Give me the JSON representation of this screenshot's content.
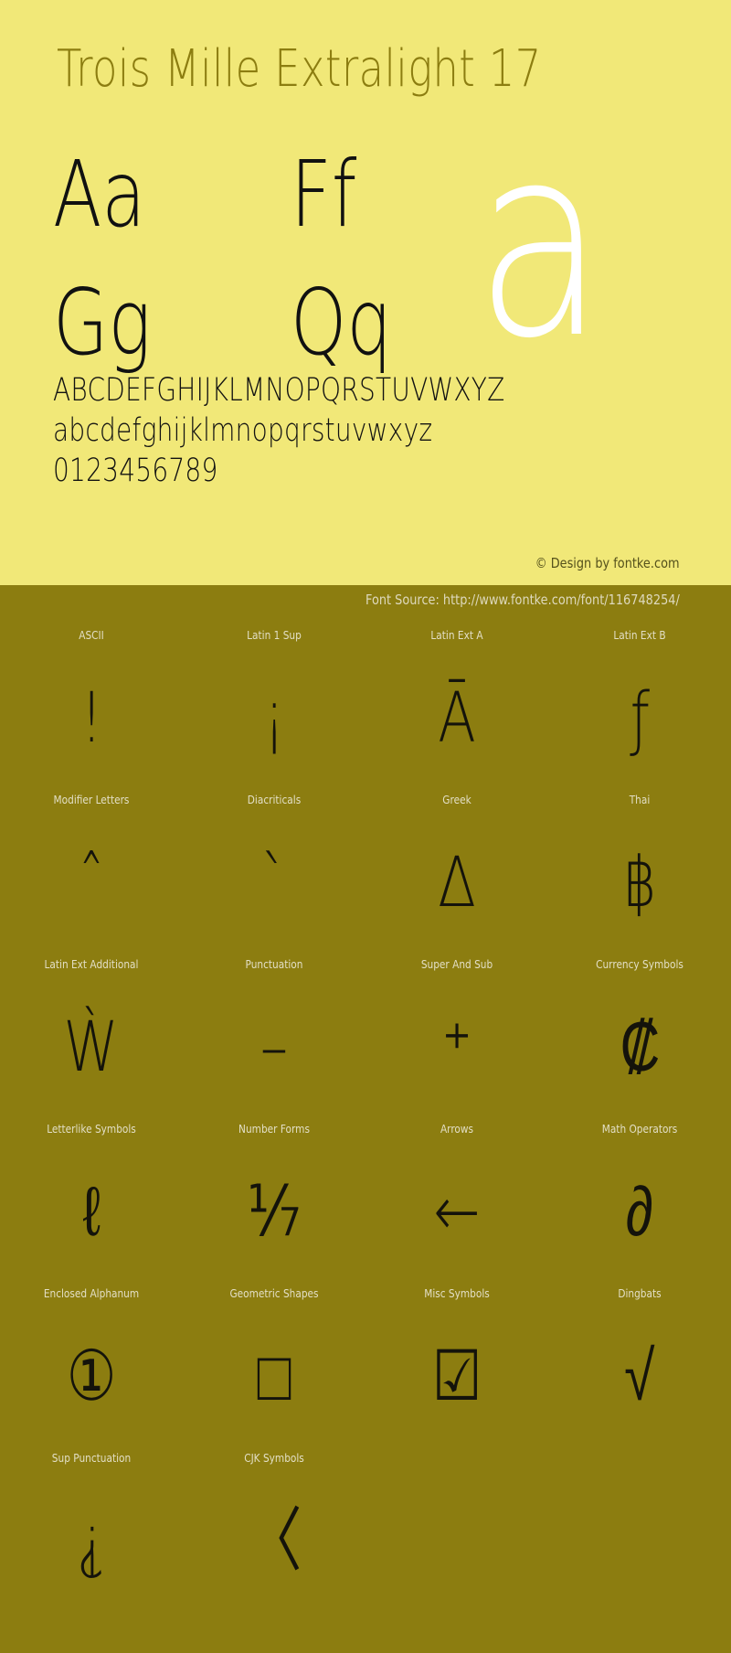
{
  "hero": {
    "title": "Trois Mille Extralight 17",
    "watermark_glyph": "a",
    "letter_pairs": [
      [
        "Aa",
        "Ff"
      ],
      [
        "Gg",
        "Qq"
      ]
    ],
    "alphabet_uppercase": "ABCDEFGHIJKLMNOPQRSTUVWXYZ",
    "alphabet_lowercase": "abcdefghijklmnopqrstuvwxyz",
    "digits": "0123456789",
    "credit": "© Design by fontke.com",
    "background_color": "#f1e878",
    "title_color": "#8c7d10",
    "glyph_color": "#111111"
  },
  "source": {
    "text": "Font Source: http://www.fontke.com/font/116748254/",
    "background_color": "#8c7d10",
    "text_color": "#ded9bd"
  },
  "grid": {
    "rows": [
      {
        "labels": [
          "ASCII",
          "Latin 1 Sup",
          "Latin Ext A",
          "Latin Ext B"
        ],
        "glyphs": [
          "!",
          "¡",
          "Ā",
          "ƒ"
        ]
      },
      {
        "labels": [
          "Modifier Letters",
          "Diacriticals",
          "Greek",
          "Thai"
        ],
        "glyphs": [
          "ˆ",
          "ˋ",
          "Δ",
          "฿"
        ]
      },
      {
        "labels": [
          "Latin Ext Additional",
          "Punctuation",
          "Super And Sub",
          "Currency Symbols"
        ],
        "glyphs": [
          "Ẁ",
          "–",
          "⁺",
          "₡"
        ]
      },
      {
        "labels": [
          "Letterlike Symbols",
          "Number Forms",
          "Arrows",
          "Math Operators"
        ],
        "glyphs": [
          "ℓ",
          "⅐",
          "←",
          "∂"
        ]
      },
      {
        "labels": [
          "Enclosed Alphanum",
          "Geometric Shapes",
          "Misc Symbols",
          "Dingbats"
        ],
        "glyphs": [
          "①",
          "□",
          "☑",
          "√"
        ]
      },
      {
        "labels": [
          "Sup Punctuation",
          "CJK Symbols",
          "",
          ""
        ],
        "glyphs": [
          "⸘",
          "〈",
          "",
          ""
        ]
      }
    ],
    "background_color": "#8c7d10",
    "label_color": "#e3dfc6",
    "glyph_color": "#14130b"
  }
}
